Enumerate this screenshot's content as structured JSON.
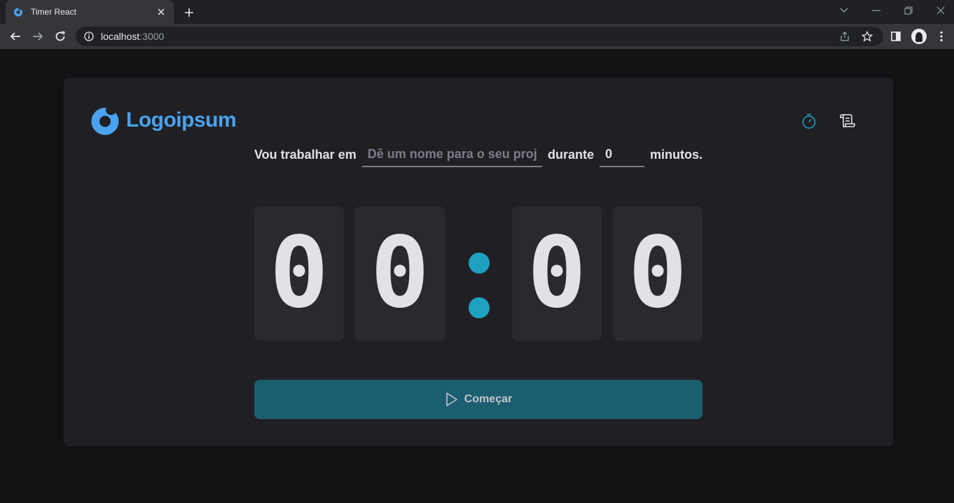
{
  "browser": {
    "tab_title": "Timer React",
    "url_host": "localhost",
    "url_port": ":3000"
  },
  "app": {
    "logo_text": "Logoipsum",
    "colors": {
      "accent": "#4aa3f0",
      "timer_dots": "#1ea1c0",
      "start_button": "#1b5e70",
      "card_bg": "#202024",
      "digit_bg": "#29292e"
    },
    "nav": [
      {
        "icon": "timer-icon",
        "active": true
      },
      {
        "icon": "scroll-icon",
        "active": false
      }
    ],
    "form": {
      "label_prefix": "Vou trabalhar em",
      "task_placeholder": "Dê um nome para o seu projeto",
      "task_value": "",
      "label_middle": "durante",
      "minutes_value": "0",
      "label_suffix": "minutos."
    },
    "countdown": {
      "minutes_tens": "0",
      "minutes_ones": "0",
      "separator": ":",
      "seconds_tens": "0",
      "seconds_ones": "0"
    },
    "start_button": {
      "label": "Começar",
      "icon": "play-icon"
    }
  }
}
